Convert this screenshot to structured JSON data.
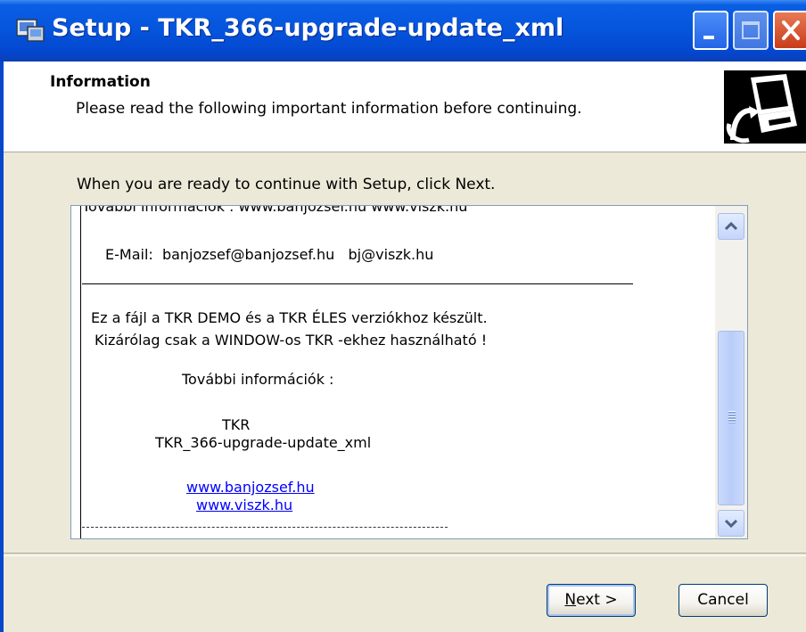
{
  "window": {
    "title": "Setup - TKR_366-upgrade-update_xml",
    "controls": [
      "minimize-icon",
      "maximize-icon",
      "close-icon"
    ]
  },
  "header": {
    "title": "Information",
    "subtitle": "Please read the following important information before continuing."
  },
  "intro_text": "When you are ready to continue with Setup, click Next.",
  "memo": {
    "lines": {
      "clipped_top": "További információk : www.banjozsef.hu   www.viszk.hu",
      "email_label": "E-Mail:",
      "email_1": "banjozsef@banjozsef.hu",
      "email_2": "bj@viszk.hu",
      "line_1": "Ez a fájl a TKR DEMO és a TKR ÉLES verziókhoz készült.",
      "line_2": "Kizárólag csak a WINDOW-os TKR -ekhez használható !",
      "more_info": "További információk :",
      "product": "TKR",
      "package": "TKR_366-upgrade-update_xml",
      "link_1": "www.banjozsef.hu",
      "link_2": "www.viszk.hu"
    }
  },
  "buttons": {
    "next_mnemonic": "N",
    "next_rest": "ext >",
    "cancel": "Cancel"
  },
  "colors": {
    "titlebar": "#0554dc",
    "dialog_bg": "#ece9d8",
    "link": "#0000ff"
  }
}
